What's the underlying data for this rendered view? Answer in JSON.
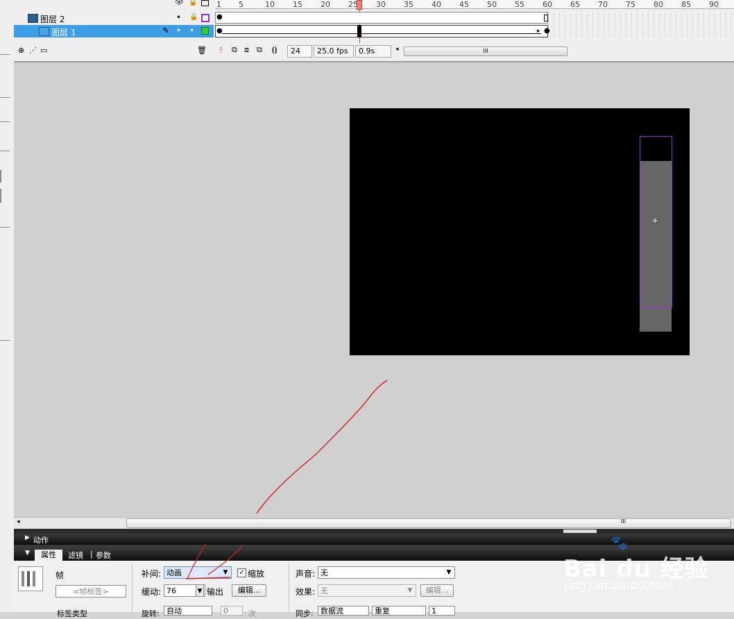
{
  "timeline": {
    "layers": [
      {
        "name": "图层 2",
        "selected": false,
        "outline_color": "#9933cc"
      },
      {
        "name": "图层 1",
        "selected": true,
        "outline_color": "#33cc33"
      }
    ],
    "ruler_ticks": [
      "1",
      "5",
      "10",
      "15",
      "20",
      "25",
      "30",
      "35",
      "40",
      "45",
      "50",
      "55",
      "60",
      "65",
      "70",
      "75",
      "80",
      "85",
      "90"
    ],
    "current_frame": "24",
    "fps": "25.0 fps",
    "elapsed": "0.9s",
    "scroll_grip": "III"
  },
  "stage": {
    "scroll_grip": "III"
  },
  "panels": {
    "actions_title": "动作",
    "tabs": [
      {
        "label": "属性",
        "active": true
      },
      {
        "label": "滤镜",
        "active": false
      },
      {
        "label": "参数",
        "active": false
      }
    ]
  },
  "properties": {
    "frame_label": "帧",
    "frame_label_placeholder": "<帧标签>",
    "label_type": "标签类型",
    "tween_label": "补间:",
    "tween_value": "动画",
    "scale_label": "缩放",
    "scale_checked": true,
    "ease_label": "缓动:",
    "ease_value": "76",
    "ease_output": "输出",
    "edit_button": "编辑...",
    "rotate_label": "旋转:",
    "rotate_value": "自动",
    "rotate_times": "0",
    "rotate_unit": "次",
    "sound_label": "声音:",
    "sound_value": "无",
    "effect_label": "效果:",
    "effect_value": "无",
    "effect_edit_button": "编辑...",
    "sync_label": "同步:",
    "sync_value": "数据流",
    "repeat_value": "重复",
    "repeat_count": "1"
  },
  "watermark": {
    "brand": "Bai du 经验",
    "url": "jingyan.baidu.com"
  }
}
